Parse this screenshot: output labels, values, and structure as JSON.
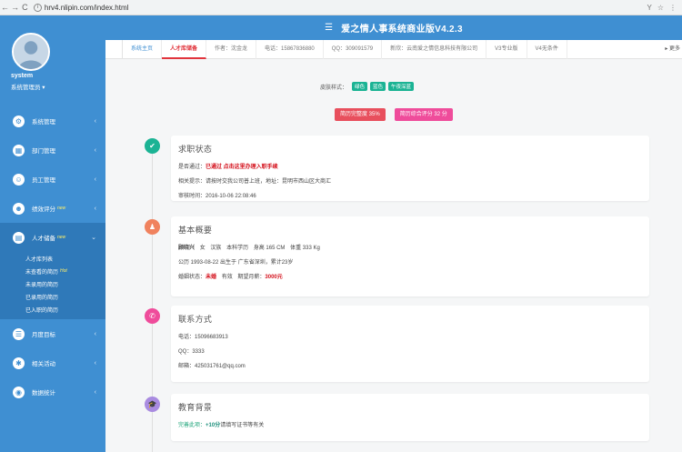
{
  "browser": {
    "url": "hrv4.nlipin.com/index.html"
  },
  "app": {
    "title": "爱之情人事系统商业版V4.2.3",
    "username": "system",
    "role": "系统管理员"
  },
  "sidebar": {
    "items": [
      {
        "label": "系统管理",
        "icon": "gear-icon",
        "glyph": "⚙"
      },
      {
        "label": "部门管理",
        "icon": "department-icon",
        "glyph": "▦"
      },
      {
        "label": "员工管理",
        "icon": "staff-icon",
        "glyph": "☺"
      },
      {
        "label": "绩效评分",
        "icon": "score-icon",
        "glyph": "☻",
        "badge": "new"
      },
      {
        "label": "人才储备",
        "icon": "talent-icon",
        "glyph": "▤",
        "badge": "new"
      },
      {
        "label": "月度目标",
        "icon": "target-icon",
        "glyph": "☰"
      },
      {
        "label": "相关活动",
        "icon": "activity-icon",
        "glyph": "✱"
      },
      {
        "label": "数据统计",
        "icon": "stats-icon",
        "glyph": "◉"
      }
    ],
    "submenu": [
      {
        "label": "人才库列表"
      },
      {
        "label": "未查看的简历",
        "badge": "Hot"
      },
      {
        "label": "未录用的简历"
      },
      {
        "label": "已录用的简历"
      },
      {
        "label": "已入职的简历"
      }
    ]
  },
  "tabs": [
    {
      "label": "系统主页"
    },
    {
      "label": "人才库储备"
    },
    {
      "label": "作者：沈金龙"
    },
    {
      "label": "电话：15867836880"
    },
    {
      "label": "QQ：309091579"
    },
    {
      "label": "新欣：云南爱之情信息科技有限公司"
    },
    {
      "label": "V3专业版"
    },
    {
      "label": "V4无条件"
    }
  ],
  "tabs_more": "▸ 更多",
  "skin": {
    "label": "皮肤样式：",
    "options": [
      "绿色",
      "蓝色",
      "午夜深蓝"
    ]
  },
  "pills": {
    "resume_complete": "简历完整度 35%",
    "score": "简历综合评分 32 分"
  },
  "sections": {
    "status": {
      "title": "求职状态",
      "pass_label": "是否通过：",
      "pass_value": "已通过 点击这里办理入职手续",
      "contact_label": "相关提示：请按时交我公司普上班，地址：昆明市西山区大商汇",
      "review_time": "审核时间：2016-10-06 22:08:46"
    },
    "profile": {
      "title": "基本概要",
      "name": "顾晓兴",
      "gender": "女",
      "ethnic": "汉族",
      "education": "本科学历",
      "height": "身高 165 CM",
      "weight": "体重 333 Kg",
      "birth": "公历 1993-08-22 出生于 广东省深圳，累计23岁",
      "marriage_label": "婚姻状态：",
      "marriage": "未婚",
      "nationality": "有效",
      "salary_label": "期望月薪：",
      "salary": "3000元"
    },
    "contact": {
      "title": "联系方式",
      "phone": "电话：15096683913",
      "qq": "QQ：3333",
      "email": "邮箱：425031761@qq.com"
    },
    "education": {
      "title": "教育背景",
      "bonus_label": "完善此项：",
      "bonus_value": "+10分",
      "bonus_hint": "请填写证书等有关"
    }
  },
  "colors": {
    "primary": "#3f8fd2",
    "status_green": "#1bb394",
    "profile_orange": "#f0825e",
    "contact_pink": "#ef4c9b",
    "edu_purple": "#a98be0"
  }
}
